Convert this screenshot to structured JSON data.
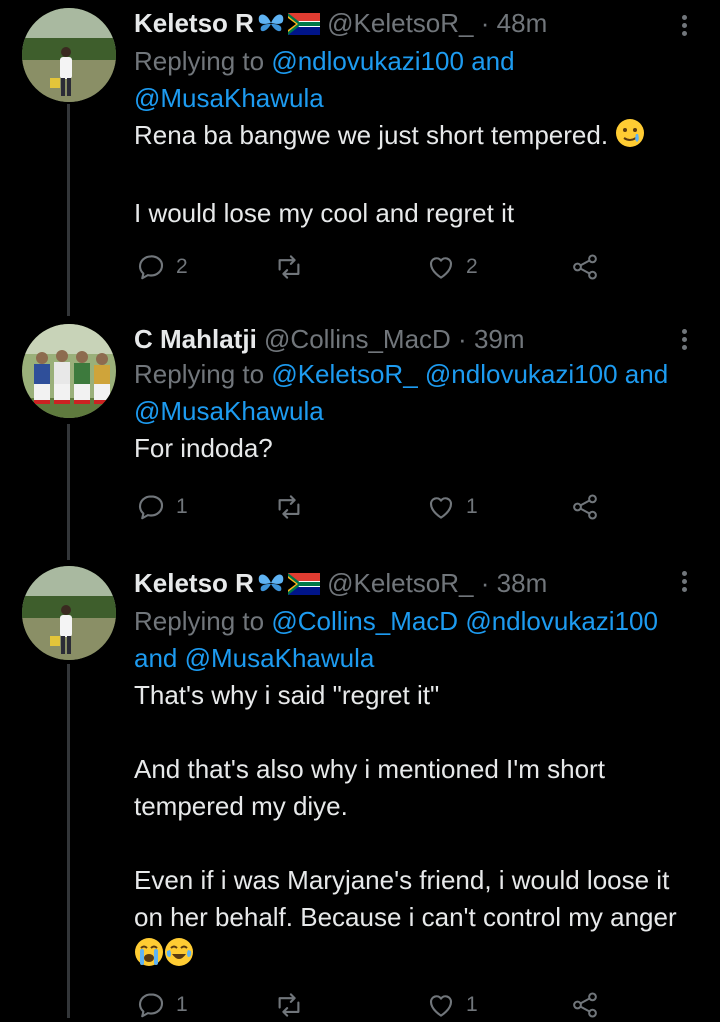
{
  "tweets": [
    {
      "name": "Keletso R",
      "handle": "@KeletsoR_",
      "separator": "·",
      "time": "48m",
      "replying_prefix": "Replying to",
      "mentions": [
        "@ndlovukazi100",
        "@MusaKhawula"
      ],
      "mention_joiners": [
        "and"
      ],
      "paragraphs": [
        "Rena ba bangwe we just short tempered.",
        "I would lose my cool and regret it"
      ],
      "reply_count": "2",
      "retweet_count": "",
      "like_count": "2"
    },
    {
      "name": "C Mahlatji",
      "handle": "@Collins_MacD",
      "separator": "·",
      "time": "39m",
      "replying_prefix": "Replying to",
      "mentions": [
        "@KeletsoR_",
        "@ndlovukazi100",
        "@MusaKhawula"
      ],
      "mention_joiners": [
        "and"
      ],
      "paragraphs": [
        "For indoda?"
      ],
      "reply_count": "1",
      "retweet_count": "",
      "like_count": "1"
    },
    {
      "name": "Keletso R",
      "handle": "@KeletsoR_",
      "separator": "·",
      "time": "38m",
      "replying_prefix": "Replying to",
      "mentions": [
        "@Collins_MacD",
        "@ndlovukazi100",
        "@MusaKhawula"
      ],
      "mention_joiners": [
        "and"
      ],
      "paragraphs": [
        "That's why i said \"regret it\"",
        "And that's also why i mentioned I'm short tempered my diye.",
        "Even if i was Maryjane's friend, i would loose it on her behalf. Because i can't control my anger"
      ],
      "reply_count": "1",
      "retweet_count": "",
      "like_count": "1"
    }
  ],
  "icons": {
    "reply": "reply-icon",
    "retweet": "retweet-icon",
    "like": "heart-icon",
    "share": "share-icon",
    "more": "more-options-icon"
  },
  "colors": {
    "background": "#000000",
    "text": "#e7e9ea",
    "muted": "#71767b",
    "link": "#1d9bf0"
  }
}
